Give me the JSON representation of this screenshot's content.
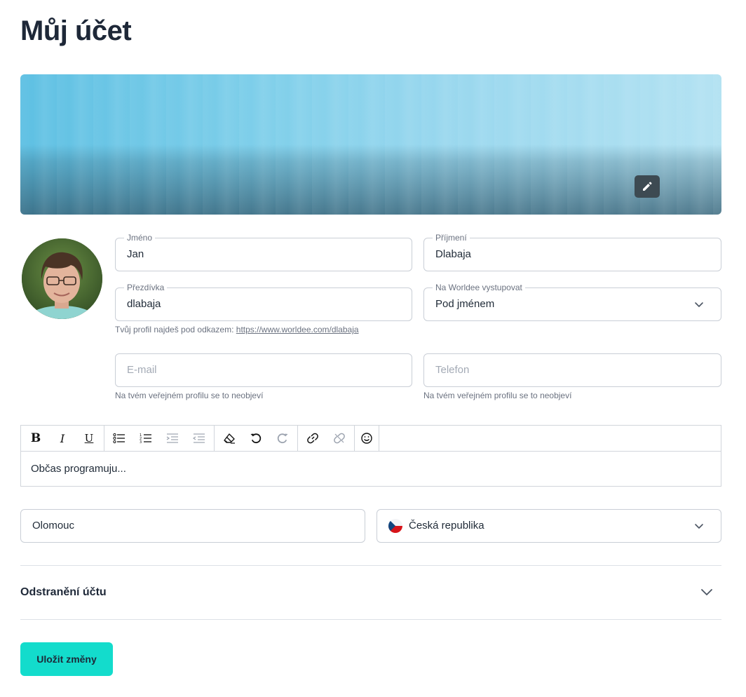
{
  "page": {
    "title": "Můj účet"
  },
  "cover": {
    "edit_icon": "pencil-icon"
  },
  "form": {
    "first_name": {
      "label": "Jméno",
      "value": "Jan"
    },
    "last_name": {
      "label": "Příjmení",
      "value": "Dlabaja"
    },
    "nickname": {
      "label": "Přezdívka",
      "value": "dlabaja"
    },
    "profile_hint_text": "Tvůj profil najdeš pod odkazem:",
    "profile_link": "https://www.worldee.com/dlabaja",
    "display_as": {
      "label": "Na Worldee vystupovat",
      "value": "Pod jménem"
    },
    "email": {
      "placeholder": "E-mail",
      "hint": "Na tvém veřejném profilu se to neobjeví"
    },
    "phone": {
      "placeholder": "Telefon",
      "hint": "Na tvém veřejném profilu se to neobjeví"
    },
    "city": {
      "value": "Olomouc"
    },
    "country": {
      "value": "Česká republika"
    }
  },
  "editor": {
    "content": "Občas programuju...",
    "toolbar_icons": [
      "bold-icon",
      "italic-icon",
      "underline-icon",
      "bullet-list-icon",
      "numbered-list-icon",
      "outdent-icon",
      "indent-icon",
      "eraser-icon",
      "undo-icon",
      "redo-icon",
      "link-icon",
      "unlink-icon",
      "emoji-icon"
    ]
  },
  "account_removal": {
    "title": "Odstranění účtu"
  },
  "actions": {
    "save_label": "Uložit změny"
  },
  "colors": {
    "accent": "#13dccc",
    "title": "#1e2838",
    "border": "#c9ced6"
  }
}
